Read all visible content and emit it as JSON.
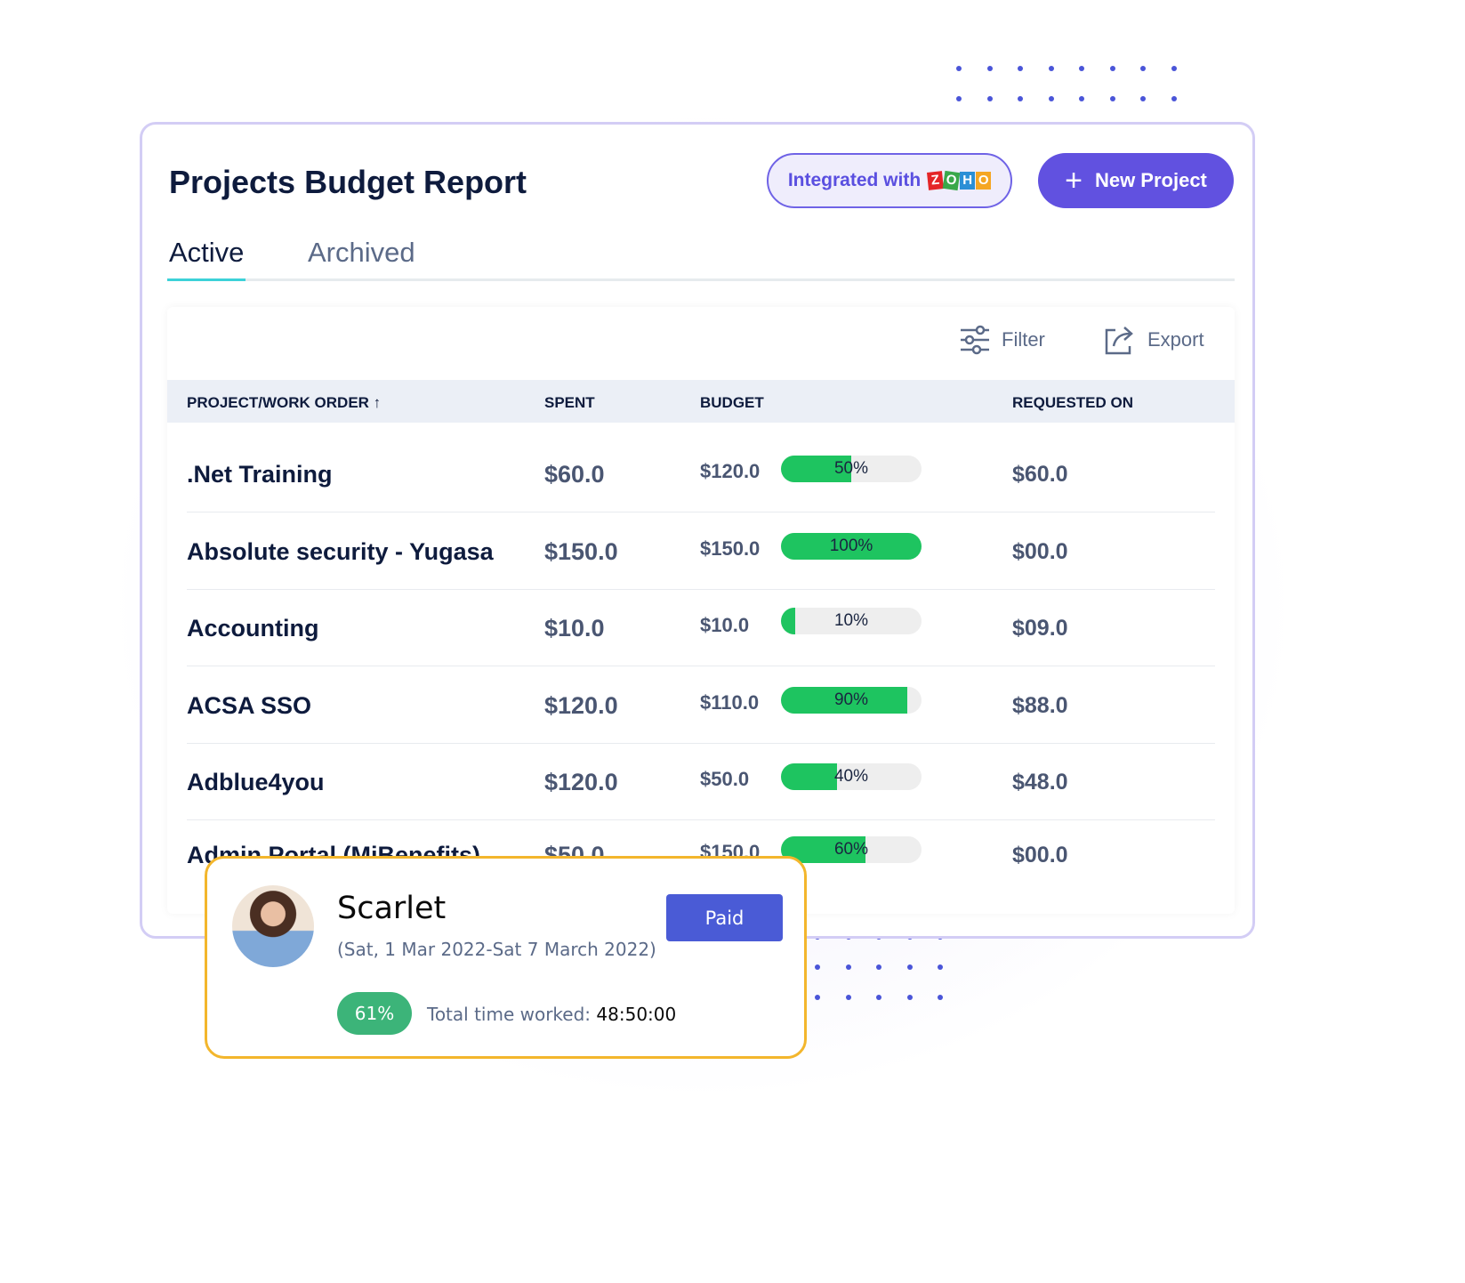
{
  "header": {
    "title": "Projects Budget Report",
    "integration_label": "Integrated with",
    "integration_logo": "ZOHO",
    "new_project_label": "New Project"
  },
  "tabs": [
    {
      "label": "Active",
      "active": true
    },
    {
      "label": "Archived",
      "active": false
    }
  ],
  "toolbar": {
    "filter_label": "Filter",
    "export_label": "Export"
  },
  "table": {
    "columns": [
      "PROJECT/WORK ORDER ↑",
      "SPENT",
      "BUDGET",
      "REQUESTED ON"
    ],
    "rows": [
      {
        "name": ".Net Training",
        "spent": "$60.0",
        "budget": "$120.0",
        "percent": 50,
        "percent_label": "50%",
        "requested": "$60.0"
      },
      {
        "name": "Absolute security - Yugasa",
        "spent": "$150.0",
        "budget": "$150.0",
        "percent": 100,
        "percent_label": "100%",
        "requested": "$00.0"
      },
      {
        "name": "Accounting",
        "spent": "$10.0",
        "budget": "$10.0",
        "percent": 10,
        "percent_label": "10%",
        "requested": "$09.0"
      },
      {
        "name": "ACSA SSO",
        "spent": "$120.0",
        "budget": "$110.0",
        "percent": 90,
        "percent_label": "90%",
        "requested": "$88.0"
      },
      {
        "name": "Adblue4you",
        "spent": "$120.0",
        "budget": "$50.0",
        "percent": 40,
        "percent_label": "40%",
        "requested": "$48.0"
      },
      {
        "name": "Admin Portal (MiBenefits)",
        "spent": "$50.0",
        "budget": "$150.0",
        "percent": 60,
        "percent_label": "60%",
        "requested": "$00.0"
      }
    ]
  },
  "popup": {
    "name": "Scarlet",
    "dates": "(Sat, 1 Mar 2022-Sat 7 March 2022)",
    "status": "Paid",
    "percent_label": "61%",
    "time_label": "Total time worked:",
    "time_value": "48:50:00"
  },
  "colors": {
    "accent": "#6151e0",
    "progress": "#1ec460",
    "popup_border": "#f3b62c",
    "paid": "#4a5bd6",
    "badge": "#3cb479"
  }
}
